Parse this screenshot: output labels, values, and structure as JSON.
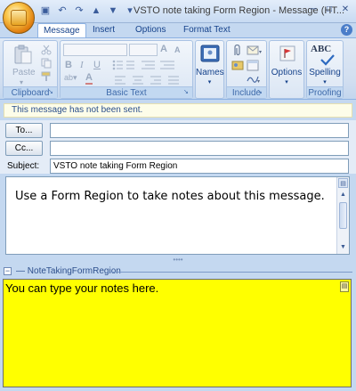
{
  "window": {
    "title": "VSTO note taking Form Region - Message (HT...",
    "qat_icons": [
      "save-icon",
      "undo-icon",
      "redo-icon",
      "up-arrow-icon",
      "down-arrow-icon",
      "customize-icon"
    ]
  },
  "tabs": [
    {
      "label": "Message",
      "active": true
    },
    {
      "label": "Insert"
    },
    {
      "label": "Options"
    },
    {
      "label": "Format Text"
    }
  ],
  "ribbon": {
    "clipboard": {
      "label": "Clipboard",
      "paste": "Paste"
    },
    "basic_text": {
      "label": "Basic Text",
      "bold": "B",
      "italic": "I",
      "underline": "U",
      "font_grow": "A",
      "font_shrink": "A"
    },
    "names": {
      "label": "Names"
    },
    "include": {
      "label": "Include"
    },
    "options": {
      "label": "Options"
    },
    "proofing": {
      "label": "Proofing",
      "spelling": "Spelling",
      "abc": "ABC"
    }
  },
  "info": {
    "message": "This message has not been sent."
  },
  "header": {
    "to_button": "To...",
    "cc_button": "Cc...",
    "to_value": "",
    "cc_value": "",
    "subject_label": "Subject:",
    "subject_value": "VSTO note taking Form Region"
  },
  "body": {
    "text": "Use a Form Region to take notes about this message."
  },
  "form_region": {
    "name": "NoteTakingFormRegion",
    "notes_text": "You can type your notes here.",
    "background": "#ffff00"
  },
  "colors": {
    "chrome": "#c4d8f0",
    "accent": "#15428b"
  }
}
